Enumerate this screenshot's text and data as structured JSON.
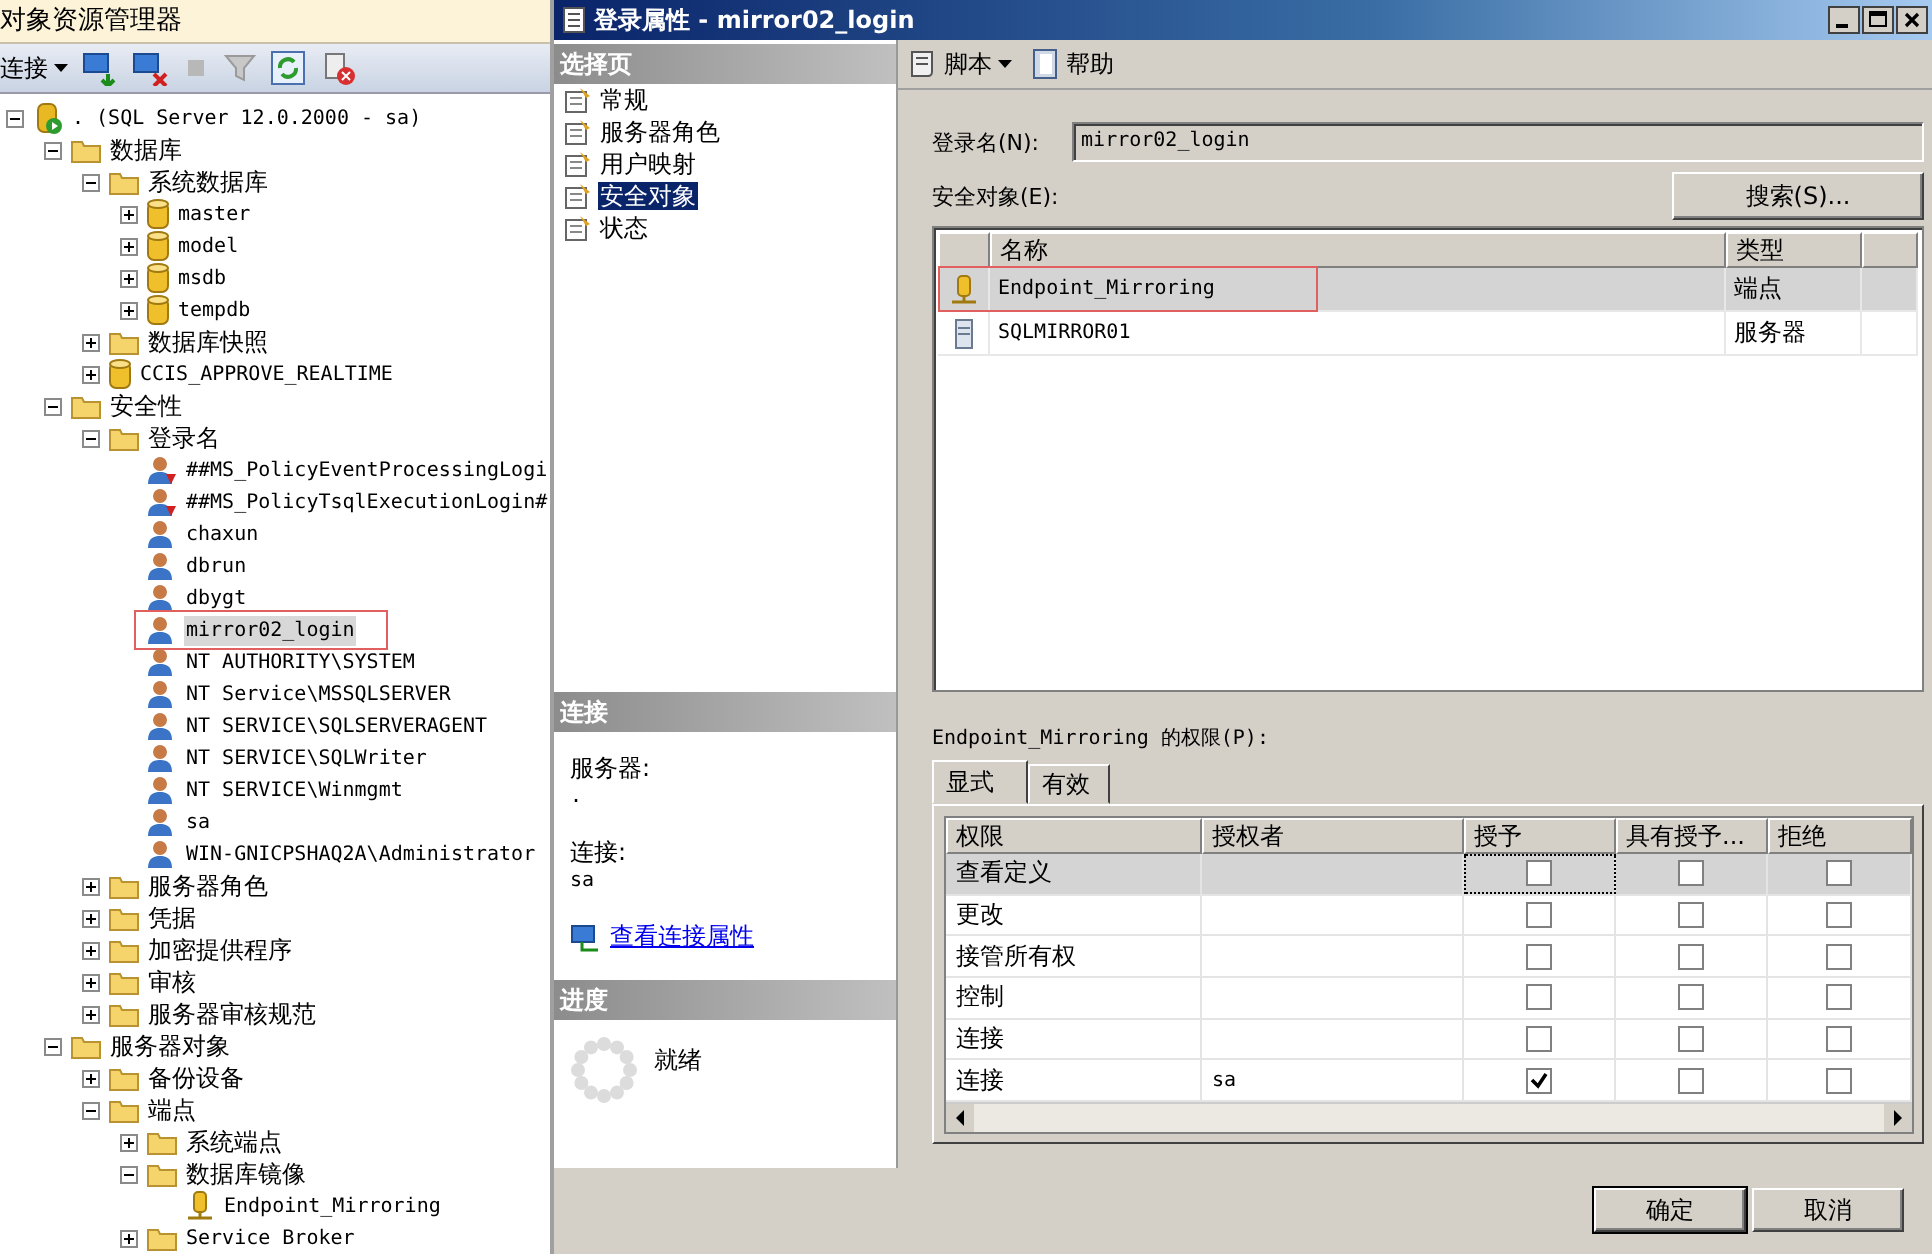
{
  "explorer": {
    "title": "对象资源管理器",
    "connect": "连接",
    "tree": [
      {
        "label": ". (SQL Server 12.0.2000 - sa)",
        "kind": "server",
        "expanded": true,
        "selected": false,
        "highlighted": false,
        "children": [
          {
            "label": "数据库",
            "kind": "folder",
            "expanded": true,
            "selected": false,
            "highlighted": false,
            "children": [
              {
                "label": "系统数据库",
                "kind": "folder",
                "expanded": true,
                "selected": false,
                "highlighted": false,
                "children": [
                  {
                    "label": "master",
                    "kind": "database",
                    "expanded": false,
                    "selected": false,
                    "highlighted": false
                  },
                  {
                    "label": "model",
                    "kind": "database",
                    "expanded": false,
                    "selected": false,
                    "highlighted": false
                  },
                  {
                    "label": "msdb",
                    "kind": "database",
                    "expanded": false,
                    "selected": false,
                    "highlighted": false
                  },
                  {
                    "label": "tempdb",
                    "kind": "database",
                    "expanded": false,
                    "selected": false,
                    "highlighted": false
                  }
                ]
              },
              {
                "label": "数据库快照",
                "kind": "folder",
                "expanded": false,
                "selected": false,
                "highlighted": false
              },
              {
                "label": "CCIS_APPROVE_REALTIME",
                "kind": "database",
                "expanded": false,
                "selected": false,
                "highlighted": false
              }
            ]
          },
          {
            "label": "安全性",
            "kind": "folder",
            "expanded": true,
            "selected": false,
            "highlighted": false,
            "children": [
              {
                "label": "登录名",
                "kind": "folder",
                "expanded": true,
                "selected": false,
                "highlighted": false,
                "children": [
                  {
                    "label": "##MS_PolicyEventProcessingLogi",
                    "kind": "login-arrow",
                    "selected": false,
                    "highlighted": false
                  },
                  {
                    "label": "##MS_PolicyTsqlExecutionLogin#",
                    "kind": "login-arrow",
                    "selected": false,
                    "highlighted": false
                  },
                  {
                    "label": "chaxun",
                    "kind": "login",
                    "selected": false,
                    "highlighted": false
                  },
                  {
                    "label": "dbrun",
                    "kind": "login",
                    "selected": false,
                    "highlighted": false
                  },
                  {
                    "label": "dbygt",
                    "kind": "login",
                    "selected": false,
                    "highlighted": false
                  },
                  {
                    "label": "mirror02_login",
                    "kind": "login",
                    "selected": true,
                    "highlighted": true
                  },
                  {
                    "label": "NT AUTHORITY\\SYSTEM",
                    "kind": "login",
                    "selected": false,
                    "highlighted": false
                  },
                  {
                    "label": "NT Service\\MSSQLSERVER",
                    "kind": "login",
                    "selected": false,
                    "highlighted": false
                  },
                  {
                    "label": "NT SERVICE\\SQLSERVERAGENT",
                    "kind": "login",
                    "selected": false,
                    "highlighted": false
                  },
                  {
                    "label": "NT SERVICE\\SQLWriter",
                    "kind": "login",
                    "selected": false,
                    "highlighted": false
                  },
                  {
                    "label": "NT SERVICE\\Winmgmt",
                    "kind": "login",
                    "selected": false,
                    "highlighted": false
                  },
                  {
                    "label": "sa",
                    "kind": "login",
                    "selected": false,
                    "highlighted": false
                  },
                  {
                    "label": "WIN-GNICPSHAQ2A\\Administrator",
                    "kind": "login",
                    "selected": false,
                    "highlighted": false
                  }
                ]
              },
              {
                "label": "服务器角色",
                "kind": "folder",
                "expanded": false,
                "selected": false,
                "highlighted": false
              },
              {
                "label": "凭据",
                "kind": "folder",
                "expanded": false,
                "selected": false,
                "highlighted": false
              },
              {
                "label": "加密提供程序",
                "kind": "folder",
                "expanded": false,
                "selected": false,
                "highlighted": false
              },
              {
                "label": "审核",
                "kind": "folder",
                "expanded": false,
                "selected": false,
                "highlighted": false
              },
              {
                "label": "服务器审核规范",
                "kind": "folder",
                "expanded": false,
                "selected": false,
                "highlighted": false
              }
            ]
          },
          {
            "label": "服务器对象",
            "kind": "folder",
            "expanded": true,
            "selected": false,
            "highlighted": false,
            "children": [
              {
                "label": "备份设备",
                "kind": "folder",
                "expanded": false,
                "selected": false,
                "highlighted": false
              },
              {
                "label": "端点",
                "kind": "folder",
                "expanded": true,
                "selected": false,
                "highlighted": false,
                "children": [
                  {
                    "label": "系统端点",
                    "kind": "folder",
                    "expanded": false,
                    "selected": false,
                    "highlighted": false
                  },
                  {
                    "label": "数据库镜像",
                    "kind": "folder",
                    "expanded": true,
                    "selected": false,
                    "highlighted": false,
                    "children": [
                      {
                        "label": "Endpoint_Mirroring",
                        "kind": "endpoint",
                        "selected": false,
                        "highlighted": false
                      }
                    ]
                  },
                  {
                    "label": "Service Broker",
                    "kind": "folder",
                    "expanded": false,
                    "selected": false,
                    "highlighted": false
                  }
                ]
              }
            ]
          }
        ]
      }
    ]
  },
  "dialog": {
    "title": "登录属性 - mirror02_login",
    "pages_header": "选择页",
    "pages": [
      {
        "label": "常规",
        "selected": false
      },
      {
        "label": "服务器角色",
        "selected": false
      },
      {
        "label": "用户映射",
        "selected": false
      },
      {
        "label": "安全对象",
        "selected": true
      },
      {
        "label": "状态",
        "selected": false
      }
    ],
    "connection_header": "连接",
    "server_label": "服务器:",
    "server_value": ".",
    "connection_label": "连接:",
    "connection_value": "sa",
    "connection_link": "查看连接属性",
    "progress_header": "进度",
    "progress_status": "就绪",
    "toolbar": {
      "script": "脚本",
      "help": "帮助"
    },
    "login_label": "登录名(N):",
    "login_value": "mirror02_login",
    "securables_label": "安全对象(E):",
    "search_button": "搜索(S)...",
    "securables": {
      "columns": [
        "名称",
        "类型"
      ],
      "rows": [
        {
          "kind": "endpoint",
          "name": "Endpoint_Mirroring",
          "type": "端点",
          "selected": true,
          "highlighted": true
        },
        {
          "kind": "server",
          "name": "SQLMIRROR01",
          "type": "服务器",
          "selected": false,
          "highlighted": false
        }
      ]
    },
    "permissions_label": "Endpoint_Mirroring 的权限(P):",
    "permission_tabs": [
      {
        "label": "显式",
        "selected": true
      },
      {
        "label": "有效",
        "selected": false
      }
    ],
    "permissions": {
      "columns": [
        "权限",
        "授权者",
        "授予",
        "具有授予...",
        "拒绝"
      ],
      "rows": [
        {
          "permission": "查看定义",
          "grant": false,
          "with_grant": false,
          "deny": false,
          "selected": true
        },
        {
          "permission": "更改",
          "grant": false,
          "with_grant": false,
          "deny": false,
          "selected": false
        },
        {
          "permission": "接管所有权",
          "grant": false,
          "with_grant": false,
          "deny": false,
          "selected": false
        },
        {
          "permission": "控制",
          "grant": false,
          "with_grant": false,
          "deny": false,
          "selected": false
        },
        {
          "permission": "连接",
          "grant": false,
          "with_grant": false,
          "deny": false,
          "selected": false
        },
        {
          "permission": "连接",
          "grantor": "sa",
          "grant": true,
          "with_grant": false,
          "deny": false,
          "selected": false
        }
      ]
    },
    "buttons": [
      {
        "label": "确定"
      },
      {
        "label": "取消"
      }
    ]
  }
}
